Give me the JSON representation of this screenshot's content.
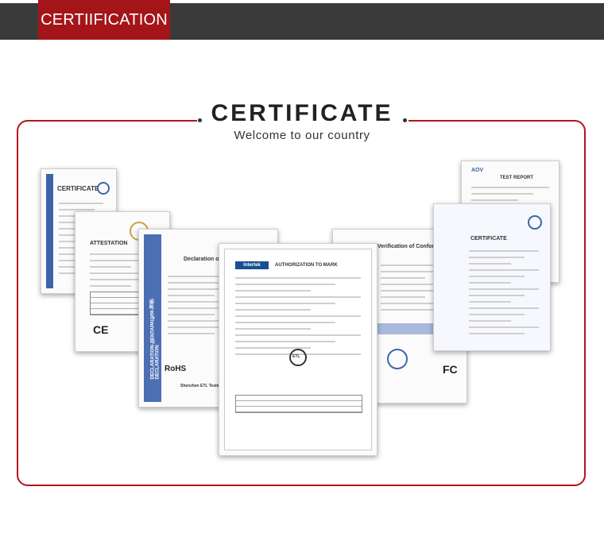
{
  "banner": {
    "tab_label": "CERTIIFICATION"
  },
  "section": {
    "title": "CERTIFICATE",
    "subtitle": "Welcome to our country"
  },
  "documents": {
    "ce_certificate": {
      "heading": "CERTIFICATE",
      "mark": "CE"
    },
    "attestation": {
      "heading": "ATTESTATION",
      "mark": "CE"
    },
    "declaration": {
      "heading": "Declaration of Conformity",
      "side_text": "DECLARATION-ДЕКЛАРАЦИЯ-声明-DECLARATION",
      "mark": "RoHS",
      "footer": "Shenzhen ETL Testing Network"
    },
    "authorization": {
      "logo": "Intertek",
      "heading": "AUTHORIZATION TO MARK",
      "mark": "ETL"
    },
    "verification": {
      "heading": "Verification of Conformity",
      "mark": "FC"
    },
    "test_report": {
      "logo": "AOV",
      "heading": "TEST REPORT"
    },
    "certificate_right": {
      "heading": "CERTIFICATE"
    }
  },
  "colors": {
    "brand_red": "#a31519",
    "bar_dark": "#3a3a3a",
    "doc_blue": "#3d63a8"
  }
}
